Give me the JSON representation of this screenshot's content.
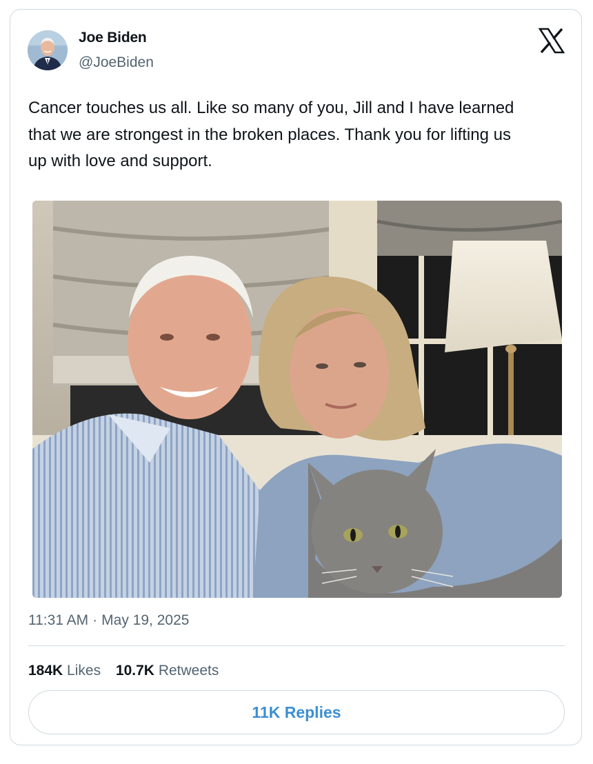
{
  "author": {
    "name": "Joe Biden",
    "handle": "@JoeBiden",
    "avatar_icon": "avatar-photo"
  },
  "platform_icon": "x-logo-icon",
  "tweet": {
    "text_lines": [
      "Cancer touches us all. Like so many of you, Jill and I have learned",
      "that we are strongest in the broken places. Thank you for lifting us",
      "up with love and support."
    ],
    "photo_icon": "selfie-photo",
    "time": "11:31 AM",
    "separator": "·",
    "date": "May 19, 2025"
  },
  "stats": {
    "likes_count": "184K",
    "likes_label": "Likes",
    "retweets_count": "10.7K",
    "retweets_label": "Retweets"
  },
  "replies_button": "11K Replies",
  "colors": {
    "text_primary": "#0f1419",
    "text_secondary": "#536471",
    "border": "#cfd9de",
    "accent": "#3b8fd4"
  }
}
